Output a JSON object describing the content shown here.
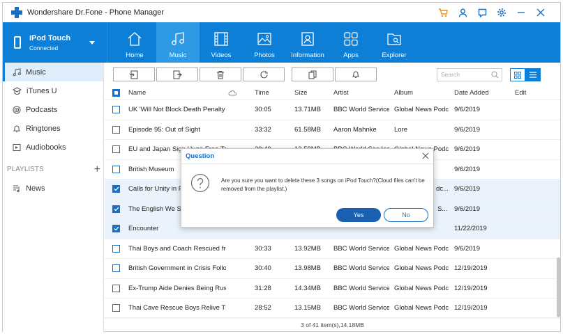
{
  "app": {
    "title": "Wondershare Dr.Fone - Phone Manager"
  },
  "device": {
    "name": "iPod Touch",
    "status": "Connected"
  },
  "nav": [
    {
      "label": "Home",
      "icon": "home-icon"
    },
    {
      "label": "Music",
      "icon": "music-icon"
    },
    {
      "label": "Videos",
      "icon": "film-icon"
    },
    {
      "label": "Photos",
      "icon": "image-icon"
    },
    {
      "label": "Information",
      "icon": "contact-card-icon"
    },
    {
      "label": "Apps",
      "icon": "apps-grid-icon"
    },
    {
      "label": "Explorer",
      "icon": "folder-search-icon"
    }
  ],
  "sidebar": {
    "items": [
      {
        "label": "Music"
      },
      {
        "label": "iTunes U"
      },
      {
        "label": "Podcasts"
      },
      {
        "label": "Ringtones"
      },
      {
        "label": "Audiobooks"
      }
    ],
    "playlists_label": "PLAYLISTS",
    "playlists": [
      {
        "label": "News"
      }
    ]
  },
  "search": {
    "placeholder": "Search"
  },
  "table": {
    "headers": {
      "name": "Name",
      "time": "Time",
      "size": "Size",
      "artist": "Artist",
      "album": "Album",
      "date": "Date Added",
      "edit": "Edit"
    },
    "rows": [
      {
        "name": "UK 'Will Not Block Death Penalty ...",
        "time": "30:05",
        "size": "13.71MB",
        "artist": "BBC World Service",
        "album": "Global News Podc...",
        "date": "9/6/2019"
      },
      {
        "name": "Episode 95: Out of Sight",
        "time": "33:32",
        "size": "61.58MB",
        "artist": "Aaron Mahnke",
        "album": "Lore",
        "date": "9/6/2019"
      },
      {
        "name": "EU and Japan Sign Huge Free Tra...",
        "time": "29:49",
        "size": "13.59MB",
        "artist": "BBC World Service",
        "album": "Global News Podc...",
        "date": "9/6/2019"
      },
      {
        "name": "British Museum",
        "time": "",
        "size": "",
        "artist": "",
        "album": "",
        "date": "9/6/2019"
      },
      {
        "name": "Calls for Unity in Pak",
        "time": "",
        "size": "",
        "artist": "",
        "album": "dc...",
        "date": "9/6/2019"
      },
      {
        "name": "The English We Spea",
        "time": "",
        "size": "",
        "artist": "",
        "album": "S...",
        "date": "9/6/2019"
      },
      {
        "name": "Encounter",
        "time": "",
        "size": "",
        "artist": "",
        "album": "",
        "date": "11/22/2019"
      },
      {
        "name": "Thai Boys and Coach Rescued fro...",
        "time": "30:33",
        "size": "13.92MB",
        "artist": "BBC World Service",
        "album": "Global News Podc...",
        "date": "9/6/2019"
      },
      {
        "name": "British Government in Crisis Follo...",
        "time": "30:40",
        "size": "13.98MB",
        "artist": "BBC World Service",
        "album": "Global News Podc...",
        "date": "12/19/2019"
      },
      {
        "name": "Ex-Trump Aide Denies Being Rus...",
        "time": "31:28",
        "size": "14.34MB",
        "artist": "BBC World Service",
        "album": "Global News Podc...",
        "date": "12/19/2019"
      },
      {
        "name": "Thai Cave Rescue Boys Relive Th...",
        "time": "28:52",
        "size": "13.15MB",
        "artist": "BBC World Service",
        "album": "Global News Podc...",
        "date": "12/19/2019"
      }
    ]
  },
  "status": {
    "text": "3 of 41 item(s),14.18MB"
  },
  "dialog": {
    "title": "Question",
    "message": "Are you sure you want to delete these 3 songs on iPod Touch?(Cloud files can't be removed from the playlist.)",
    "yes_label": "Yes",
    "no_label": "No"
  },
  "colors": {
    "brand": "#0d7fd6",
    "dialog_yes": "#1a5fb0"
  }
}
